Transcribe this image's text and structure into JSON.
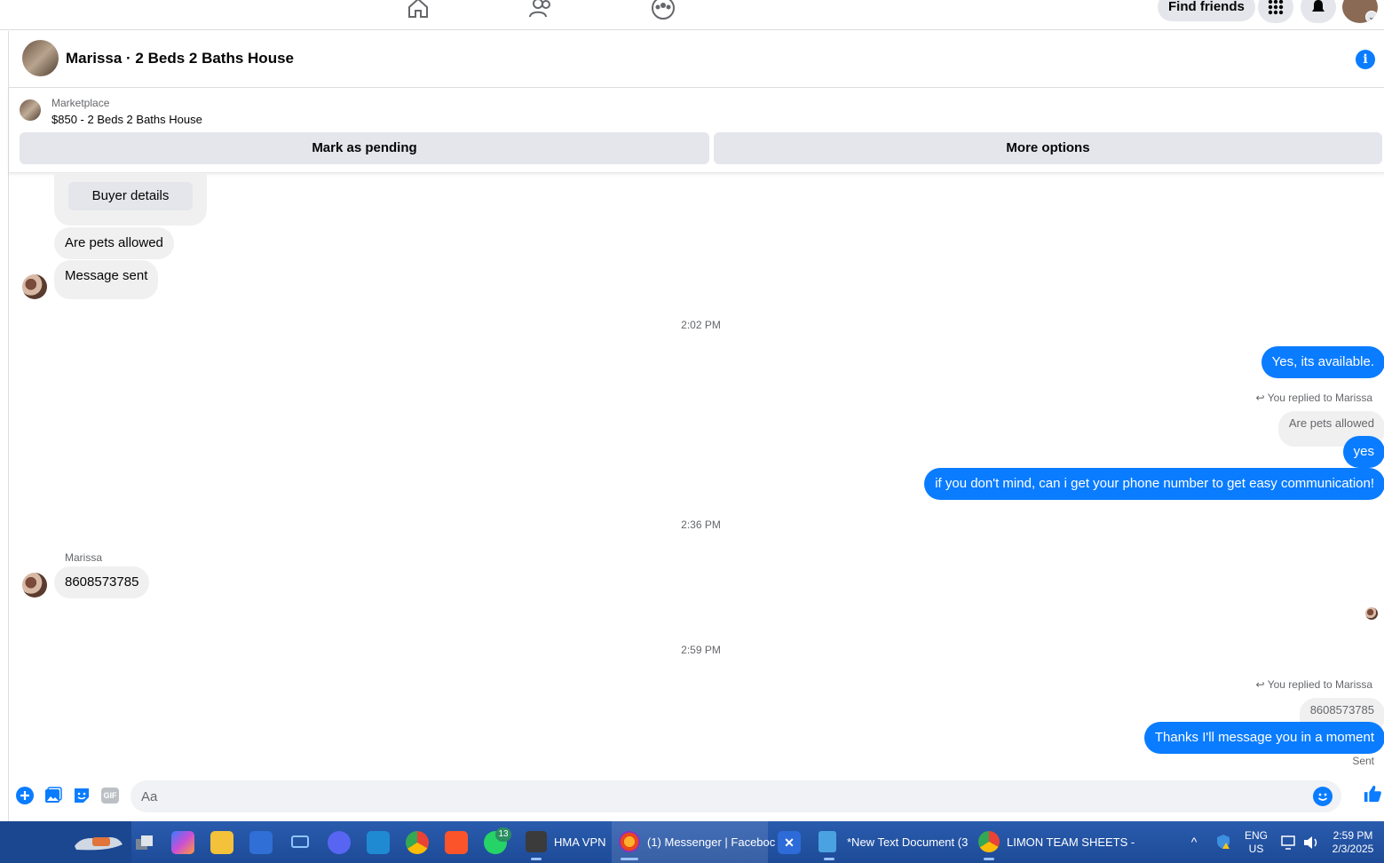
{
  "topnav": {
    "find_friends_label": "Find friends"
  },
  "conversation": {
    "title": "Marissa · 2 Beds 2 Baths House"
  },
  "marketplace": {
    "label": "Marketplace",
    "listing": "$850 - 2 Beds 2 Baths House",
    "mark_pending_label": "Mark as pending",
    "more_options_label": "More options"
  },
  "messages": {
    "buyer_details_label": "Buyer details",
    "in_1": "Are pets allowed",
    "in_2": "Message sent",
    "time_1": "2:02 PM",
    "out_1": "Yes, its available.",
    "replied_1": "You replied to Marissa",
    "quote_1": "Are pets allowed",
    "out_2": "yes",
    "out_3": "if you don't mind, can i get your phone number to get easy communication!",
    "time_2": "2:36 PM",
    "sender_name": "Marissa",
    "in_3": "8608573785",
    "time_3": "2:59 PM",
    "replied_2": "You replied to Marissa",
    "quote_2": "8608573785",
    "out_4": "Thanks I'll message you in a moment",
    "status": "Sent"
  },
  "composer": {
    "placeholder": "Aa",
    "gif_label": "GIF"
  },
  "taskbar": {
    "apps": [
      {
        "label": "HMA VPN"
      },
      {
        "label": "(1) Messenger | Faceboc"
      },
      {
        "label": "*New Text Document (3"
      },
      {
        "label": "LIMON TEAM SHEETS -"
      }
    ],
    "whatsapp_badge": "13",
    "lang_top": "ENG",
    "lang_bottom": "US",
    "time": "2:59 PM",
    "date": "2/3/2025"
  },
  "colors": {
    "accent": "#0a7cff",
    "bubble_in": "#f0f0f0",
    "taskbar": "#1f4e9b"
  }
}
